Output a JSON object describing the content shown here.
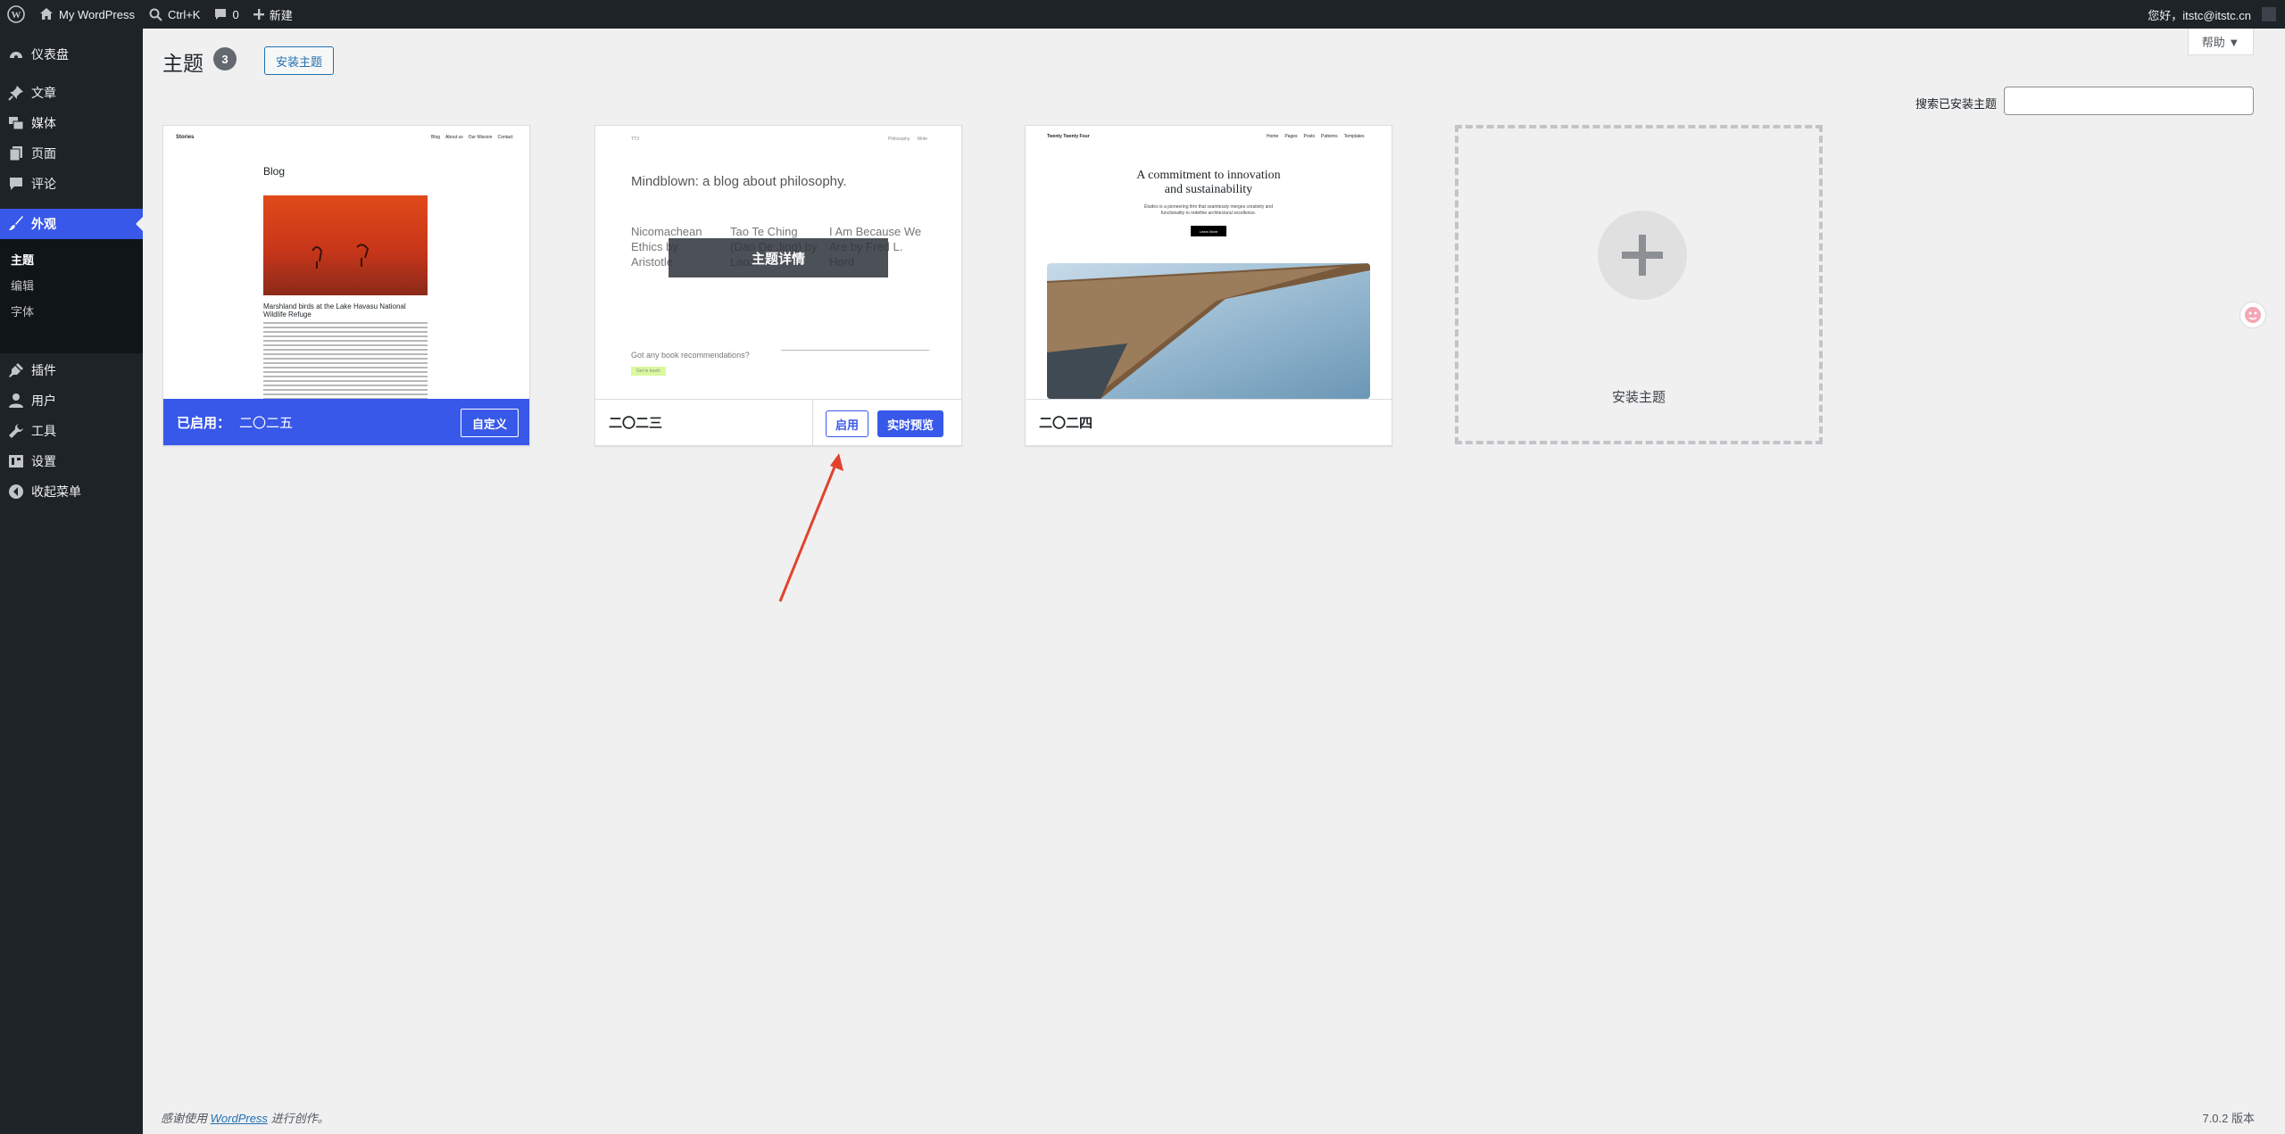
{
  "adminbar": {
    "site_name": "My WordPress",
    "search_shortcut": "Ctrl+K",
    "comments_count": "0",
    "new_label": "新建",
    "greeting": "您好，itstc@itstc.cn"
  },
  "sidebar": {
    "items": [
      {
        "label": "仪表盘",
        "icon": "dashboard-icon"
      },
      {
        "label": "文章",
        "icon": "pin-icon"
      },
      {
        "label": "媒体",
        "icon": "media-icon"
      },
      {
        "label": "页面",
        "icon": "page-icon"
      },
      {
        "label": "评论",
        "icon": "comment-icon"
      },
      {
        "label": "外观",
        "icon": "brush-icon"
      },
      {
        "label": "插件",
        "icon": "plugin-icon"
      },
      {
        "label": "用户",
        "icon": "user-icon"
      },
      {
        "label": "工具",
        "icon": "wrench-icon"
      },
      {
        "label": "设置",
        "icon": "settings-icon"
      },
      {
        "label": "收起菜单",
        "icon": "collapse-icon"
      }
    ],
    "submenu": [
      "主题",
      "编辑",
      "字体"
    ]
  },
  "header": {
    "title": "主题",
    "count": "3",
    "install_button": "安装主题",
    "help": "帮助 ▼",
    "search_label": "搜索已安装主题",
    "search_value": ""
  },
  "themes": [
    {
      "name": "二〇二五",
      "active_prefix": "已启用：",
      "customize": "自定义",
      "preview": {
        "site": "Stories",
        "nav": [
          "Blog",
          "About us",
          "Our Mission",
          "Contact"
        ],
        "heading": "Blog",
        "post_title": "Marshland birds at the Lake Havasu National Wildlife Refuge"
      }
    },
    {
      "name": "二〇二三",
      "details": "主题详情",
      "activate": "启用",
      "live_preview": "实时预览",
      "preview": {
        "site": "TT3",
        "nav": [
          "Philosophy",
          "Write"
        ],
        "heading": "Mindblown: a blog about philosophy.",
        "posts": [
          "Nicomachean Ethics by Aristotle",
          "Tao Te Ching (Dao De Jing) by Laozi",
          "I Am Because We Are by Fred L. Hord"
        ],
        "question": "Got any book recommendations?",
        "button": "Get in touch"
      }
    },
    {
      "name": "二〇二四",
      "preview": {
        "site": "Twenty Twenty Four",
        "nav": [
          "Home",
          "Pages",
          "Posts",
          "Patterns",
          "Templates"
        ],
        "heading_line1": "A commitment to innovation",
        "heading_line2": "and sustainability",
        "sub": "Études is a pioneering firm that seamlessly merges creativity and functionality to redefine architectural excellence.",
        "button": "Learn More"
      }
    }
  ],
  "add_theme_label": "安装主题",
  "footer": {
    "before": "感谢使用",
    "link": "WordPress",
    "after": "进行创作。",
    "version": "7.0.2 版本"
  }
}
